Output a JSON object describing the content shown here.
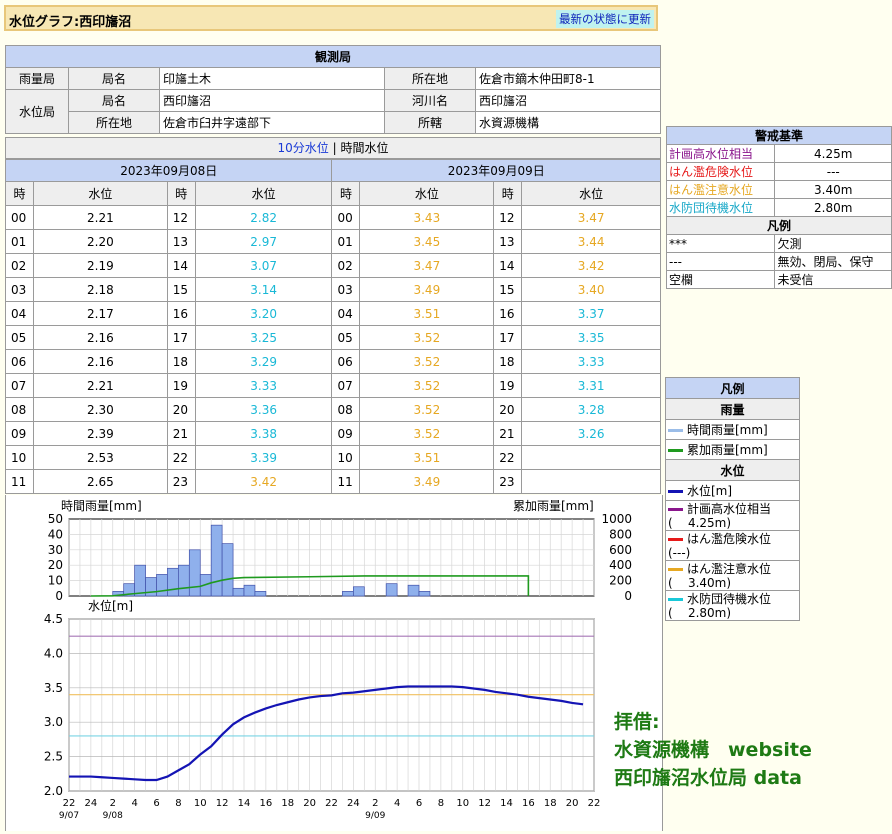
{
  "page": {
    "title": "水位グラフ:西印旛沼",
    "refresh_label": "最新の状態に更新"
  },
  "station": {
    "header": "観測局",
    "rain_label": "雨量局",
    "wl_label": "水位局",
    "name_label": "局名",
    "location_label": "所在地",
    "river_label": "河川名",
    "office_label": "所轄",
    "rain_name": "印旛土木",
    "rain_location": "佐倉市鏑木仲田町8-1",
    "wl_name": "西印旛沼",
    "wl_river": "西印旛沼",
    "wl_location": "佐倉市臼井字遠部下",
    "wl_office": "水資源機構"
  },
  "toggle": {
    "ten_min": "10分水位",
    "sep": " | ",
    "hourly": "時間水位"
  },
  "table": {
    "date1": "2023年09月08日",
    "date2": "2023年09月09日",
    "hour_label": "時",
    "level_label": "水位",
    "rows": [
      [
        "00",
        "2.21",
        "12",
        "2.82",
        "00",
        "3.43",
        "12",
        "3.47"
      ],
      [
        "01",
        "2.20",
        "13",
        "2.97",
        "01",
        "3.45",
        "13",
        "3.44"
      ],
      [
        "02",
        "2.19",
        "14",
        "3.07",
        "02",
        "3.47",
        "14",
        "3.42"
      ],
      [
        "03",
        "2.18",
        "15",
        "3.14",
        "03",
        "3.49",
        "15",
        "3.40"
      ],
      [
        "04",
        "2.17",
        "16",
        "3.20",
        "04",
        "3.51",
        "16",
        "3.37"
      ],
      [
        "05",
        "2.16",
        "17",
        "3.25",
        "05",
        "3.52",
        "17",
        "3.35"
      ],
      [
        "06",
        "2.16",
        "18",
        "3.29",
        "06",
        "3.52",
        "18",
        "3.33"
      ],
      [
        "07",
        "2.21",
        "19",
        "3.33",
        "07",
        "3.52",
        "19",
        "3.31"
      ],
      [
        "08",
        "2.30",
        "20",
        "3.36",
        "08",
        "3.52",
        "20",
        "3.28"
      ],
      [
        "09",
        "2.39",
        "21",
        "3.38",
        "09",
        "3.52",
        "21",
        "3.26"
      ],
      [
        "10",
        "2.53",
        "22",
        "3.39",
        "10",
        "3.51",
        "22",
        ""
      ],
      [
        "11",
        "2.65",
        "23",
        "3.42",
        "11",
        "3.49",
        "23",
        ""
      ]
    ],
    "colors": [
      [
        "v-black",
        "v-cyan",
        "v-orange",
        "v-orange"
      ],
      [
        "v-black",
        "v-cyan",
        "v-orange",
        "v-orange"
      ],
      [
        "v-black",
        "v-cyan",
        "v-orange",
        "v-orange"
      ],
      [
        "v-black",
        "v-cyan",
        "v-orange",
        "v-orange"
      ],
      [
        "v-black",
        "v-cyan",
        "v-orange",
        "v-cyan"
      ],
      [
        "v-black",
        "v-cyan",
        "v-orange",
        "v-cyan"
      ],
      [
        "v-black",
        "v-cyan",
        "v-orange",
        "v-cyan"
      ],
      [
        "v-black",
        "v-cyan",
        "v-orange",
        "v-cyan"
      ],
      [
        "v-black",
        "v-cyan",
        "v-orange",
        "v-cyan"
      ],
      [
        "v-black",
        "v-cyan",
        "v-orange",
        "v-cyan"
      ],
      [
        "v-black",
        "v-cyan",
        "v-orange",
        "v-cyan"
      ],
      [
        "v-black",
        "v-orange",
        "v-orange",
        "v-cyan"
      ]
    ]
  },
  "warn": {
    "header": "警戒基準",
    "items": [
      {
        "label": "計画高水位相当",
        "value": "4.25m",
        "cls": "c-purple"
      },
      {
        "label": "はん濫危険水位",
        "value": "---",
        "cls": "c-red"
      },
      {
        "label": "はん濫注意水位",
        "value": "3.40m",
        "cls": "c-orange"
      },
      {
        "label": "水防団待機水位",
        "value": "2.80m",
        "cls": "c-cyan"
      }
    ],
    "legend_header": "凡例",
    "legend": [
      {
        "sym": "***",
        "desc": "欠測"
      },
      {
        "sym": "---",
        "desc": "無効、閉局、保守"
      },
      {
        "sym": "空欄",
        "desc": "未受信"
      }
    ]
  },
  "legend2": {
    "header": "凡例",
    "rain_header": "雨量",
    "wl_header": "水位",
    "rain_items": [
      {
        "label": "時間雨量[mm]",
        "color": "#9bbde8"
      },
      {
        "label": "累加雨量[mm]",
        "color": "#1f9a1f"
      }
    ],
    "wl_items": [
      {
        "line1": "水位[m]",
        "line2": "",
        "color": "#1414b4"
      },
      {
        "line1": "計画高水位相当",
        "line2": "(    4.25m)",
        "color": "#8a168c"
      },
      {
        "line1": "はん濫危険水位",
        "line2": "(---)",
        "color": "#e61a1a"
      },
      {
        "line1": "はん濫注意水位",
        "line2": "(    3.40m)",
        "color": "#e6a823"
      },
      {
        "line1": "水防団待機水位",
        "line2": "(    2.80m)",
        "color": "#19c8d8"
      }
    ]
  },
  "chart_data": [
    {
      "type": "bar",
      "title": "",
      "ylabel": "時間雨量[mm]",
      "y2label": "累加雨量[mm]",
      "ylim": [
        0,
        50
      ],
      "y2lim": [
        0,
        1000
      ],
      "yticks": [
        "50",
        "40",
        "30",
        "20",
        "10",
        "0"
      ],
      "y2ticks": [
        "1000",
        "800",
        "600",
        "400",
        "200",
        "0"
      ],
      "hourly_rain": [
        [
          2,
          3
        ],
        [
          3,
          8
        ],
        [
          4,
          20
        ],
        [
          5,
          12
        ],
        [
          6,
          14
        ],
        [
          7,
          18
        ],
        [
          8,
          20
        ],
        [
          9,
          30
        ],
        [
          10,
          14
        ],
        [
          11,
          46
        ],
        [
          12,
          34
        ],
        [
          13,
          5
        ],
        [
          14,
          7
        ],
        [
          15,
          3
        ],
        [
          23,
          3
        ],
        [
          24,
          6
        ],
        [
          27,
          8
        ],
        [
          29,
          7
        ],
        [
          30,
          3
        ]
      ],
      "cumulative": [
        [
          0,
          0
        ],
        [
          2,
          3
        ],
        [
          4,
          31
        ],
        [
          6,
          57
        ],
        [
          8,
          95
        ],
        [
          10,
          125
        ],
        [
          11,
          171
        ],
        [
          12,
          205
        ],
        [
          13,
          230
        ],
        [
          14,
          240
        ],
        [
          20,
          250
        ],
        [
          25,
          260
        ],
        [
          40,
          260
        ],
        [
          40,
          0
        ]
      ]
    },
    {
      "type": "line",
      "ylabel": "水位[m]",
      "ylim": [
        2.0,
        4.5
      ],
      "yticks": [
        "4.5",
        "4.0",
        "3.5",
        "3.0",
        "2.5",
        "2.0"
      ],
      "xticks": [
        "22",
        "24",
        "2",
        "4",
        "6",
        "8",
        "10",
        "12",
        "14",
        "16",
        "18",
        "20",
        "22",
        "24",
        "2",
        "4",
        "6",
        "8",
        "10",
        "12",
        "14",
        "16",
        "18",
        "20",
        "22"
      ],
      "xdates": [
        {
          "i": 0,
          "text": "9/07"
        },
        {
          "i": 2,
          "text": "9/08"
        },
        {
          "i": 14,
          "text": "9/09"
        }
      ],
      "thresholds": [
        {
          "value": 4.25,
          "color": "#a676b6"
        },
        {
          "value": 3.4,
          "color": "#f0c060"
        },
        {
          "value": 2.8,
          "color": "#7ad4e4"
        }
      ],
      "level": [
        [
          -2,
          2.21
        ],
        [
          0,
          2.21
        ],
        [
          1,
          2.2
        ],
        [
          2,
          2.19
        ],
        [
          3,
          2.18
        ],
        [
          4,
          2.17
        ],
        [
          5,
          2.16
        ],
        [
          6,
          2.16
        ],
        [
          7,
          2.21
        ],
        [
          8,
          2.3
        ],
        [
          9,
          2.39
        ],
        [
          10,
          2.53
        ],
        [
          11,
          2.65
        ],
        [
          12,
          2.82
        ],
        [
          13,
          2.97
        ],
        [
          14,
          3.07
        ],
        [
          15,
          3.14
        ],
        [
          16,
          3.2
        ],
        [
          17,
          3.25
        ],
        [
          18,
          3.29
        ],
        [
          19,
          3.33
        ],
        [
          20,
          3.36
        ],
        [
          21,
          3.38
        ],
        [
          22,
          3.39
        ],
        [
          23,
          3.42
        ],
        [
          24,
          3.43
        ],
        [
          25,
          3.45
        ],
        [
          26,
          3.47
        ],
        [
          27,
          3.49
        ],
        [
          28,
          3.51
        ],
        [
          29,
          3.52
        ],
        [
          30,
          3.52
        ],
        [
          31,
          3.52
        ],
        [
          32,
          3.52
        ],
        [
          33,
          3.52
        ],
        [
          34,
          3.51
        ],
        [
          35,
          3.49
        ],
        [
          36,
          3.47
        ],
        [
          37,
          3.44
        ],
        [
          38,
          3.42
        ],
        [
          39,
          3.4
        ],
        [
          40,
          3.37
        ],
        [
          41,
          3.35
        ],
        [
          42,
          3.33
        ],
        [
          43,
          3.31
        ],
        [
          44,
          3.28
        ],
        [
          45,
          3.26
        ]
      ]
    }
  ],
  "credit": {
    "line1": "拝借:",
    "line2": "水資源機構　website",
    "line3": "西印旛沼水位局 data"
  }
}
